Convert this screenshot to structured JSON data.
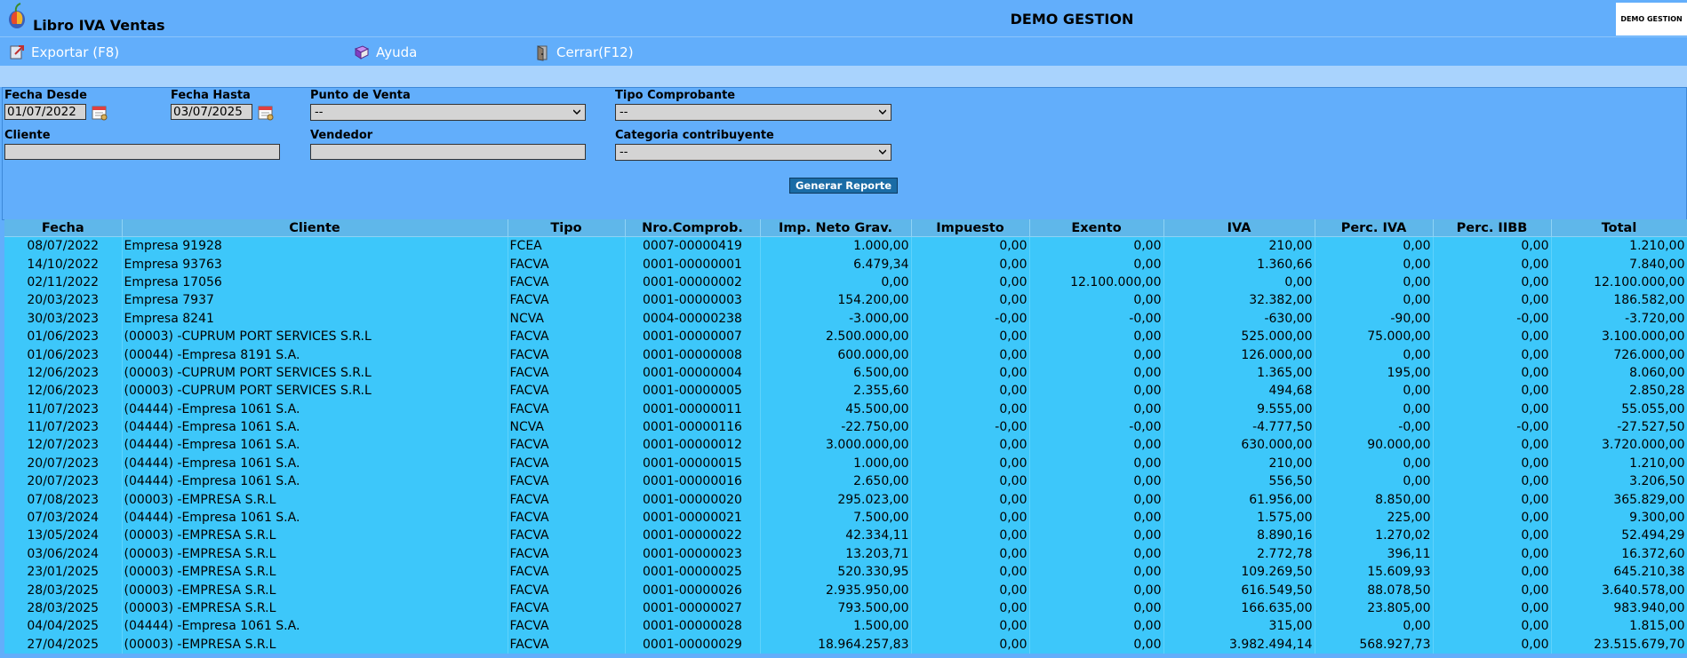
{
  "header": {
    "app_title": "Libro IVA Ventas",
    "company": "DEMO GESTION",
    "logo_text": "DEMO GESTION"
  },
  "toolbar": {
    "export_label": "Exportar (F8)",
    "help_label": "Ayuda",
    "close_label": "Cerrar(F12)"
  },
  "filters": {
    "fecha_desde_label": "Fecha Desde",
    "fecha_desde_value": "01/07/2022",
    "fecha_hasta_label": "Fecha Hasta",
    "fecha_hasta_value": "03/07/2025",
    "punto_venta_label": "Punto de Venta",
    "punto_venta_value": "--",
    "tipo_comprobante_label": "Tipo Comprobante",
    "tipo_comprobante_value": "--",
    "cliente_label": "Cliente",
    "cliente_value": "",
    "vendedor_label": "Vendedor",
    "vendedor_value": "",
    "categoria_label": "Categoria contribuyente",
    "categoria_value": "--",
    "generate_button": "Generar Reporte"
  },
  "table": {
    "columns": [
      "Fecha",
      "Cliente",
      "Tipo",
      "Nro.Comprob.",
      "Imp. Neto Grav.",
      "Impuesto",
      "Exento",
      "IVA",
      "Perc. IVA",
      "Perc. IIBB",
      "Total"
    ],
    "rows": [
      [
        "08/07/2022",
        "Empresa 91928",
        "FCEA",
        "0007-00000419",
        "1.000,00",
        "0,00",
        "0,00",
        "210,00",
        "0,00",
        "0,00",
        "1.210,00"
      ],
      [
        "14/10/2022",
        "Empresa 93763",
        "FACVA",
        "0001-00000001",
        "6.479,34",
        "0,00",
        "0,00",
        "1.360,66",
        "0,00",
        "0,00",
        "7.840,00"
      ],
      [
        "02/11/2022",
        "Empresa 17056",
        "FACVA",
        "0001-00000002",
        "0,00",
        "0,00",
        "12.100.000,00",
        "0,00",
        "0,00",
        "0,00",
        "12.100.000,00"
      ],
      [
        "20/03/2023",
        "Empresa 7937",
        "FACVA",
        "0001-00000003",
        "154.200,00",
        "0,00",
        "0,00",
        "32.382,00",
        "0,00",
        "0,00",
        "186.582,00"
      ],
      [
        "30/03/2023",
        "Empresa 8241",
        "NCVA",
        "0004-00000238",
        "-3.000,00",
        "-0,00",
        "-0,00",
        "-630,00",
        "-90,00",
        "-0,00",
        "-3.720,00"
      ],
      [
        "01/06/2023",
        "(00003) -CUPRUM PORT SERVICES S.R.L",
        "FACVA",
        "0001-00000007",
        "2.500.000,00",
        "0,00",
        "0,00",
        "525.000,00",
        "75.000,00",
        "0,00",
        "3.100.000,00"
      ],
      [
        "01/06/2023",
        "(00044) -Empresa 8191 S.A.",
        "FACVA",
        "0001-00000008",
        "600.000,00",
        "0,00",
        "0,00",
        "126.000,00",
        "0,00",
        "0,00",
        "726.000,00"
      ],
      [
        "12/06/2023",
        "(00003) -CUPRUM PORT SERVICES S.R.L",
        "FACVA",
        "0001-00000004",
        "6.500,00",
        "0,00",
        "0,00",
        "1.365,00",
        "195,00",
        "0,00",
        "8.060,00"
      ],
      [
        "12/06/2023",
        "(00003) -CUPRUM PORT SERVICES S.R.L",
        "FACVA",
        "0001-00000005",
        "2.355,60",
        "0,00",
        "0,00",
        "494,68",
        "0,00",
        "0,00",
        "2.850,28"
      ],
      [
        "11/07/2023",
        "(04444) -Empresa 1061 S.A.",
        "FACVA",
        "0001-00000011",
        "45.500,00",
        "0,00",
        "0,00",
        "9.555,00",
        "0,00",
        "0,00",
        "55.055,00"
      ],
      [
        "11/07/2023",
        "(04444) -Empresa 1061 S.A.",
        "NCVA",
        "0001-00000116",
        "-22.750,00",
        "-0,00",
        "-0,00",
        "-4.777,50",
        "-0,00",
        "-0,00",
        "-27.527,50"
      ],
      [
        "12/07/2023",
        "(04444) -Empresa 1061 S.A.",
        "FACVA",
        "0001-00000012",
        "3.000.000,00",
        "0,00",
        "0,00",
        "630.000,00",
        "90.000,00",
        "0,00",
        "3.720.000,00"
      ],
      [
        "20/07/2023",
        "(04444) -Empresa 1061 S.A.",
        "FACVA",
        "0001-00000015",
        "1.000,00",
        "0,00",
        "0,00",
        "210,00",
        "0,00",
        "0,00",
        "1.210,00"
      ],
      [
        "20/07/2023",
        "(04444) -Empresa 1061 S.A.",
        "FACVA",
        "0001-00000016",
        "2.650,00",
        "0,00",
        "0,00",
        "556,50",
        "0,00",
        "0,00",
        "3.206,50"
      ],
      [
        "07/08/2023",
        "(00003) -EMPRESA S.R.L",
        "FACVA",
        "0001-00000020",
        "295.023,00",
        "0,00",
        "0,00",
        "61.956,00",
        "8.850,00",
        "0,00",
        "365.829,00"
      ],
      [
        "07/03/2024",
        "(04444) -Empresa 1061 S.A.",
        "FACVA",
        "0001-00000021",
        "7.500,00",
        "0,00",
        "0,00",
        "1.575,00",
        "225,00",
        "0,00",
        "9.300,00"
      ],
      [
        "13/05/2024",
        "(00003) -EMPRESA S.R.L",
        "FACVA",
        "0001-00000022",
        "42.334,11",
        "0,00",
        "0,00",
        "8.890,16",
        "1.270,02",
        "0,00",
        "52.494,29"
      ],
      [
        "03/06/2024",
        "(00003) -EMPRESA S.R.L",
        "FACVA",
        "0001-00000023",
        "13.203,71",
        "0,00",
        "0,00",
        "2.772,78",
        "396,11",
        "0,00",
        "16.372,60"
      ],
      [
        "23/01/2025",
        "(00003) -EMPRESA S.R.L",
        "FACVA",
        "0001-00000025",
        "520.330,95",
        "0,00",
        "0,00",
        "109.269,50",
        "15.609,93",
        "0,00",
        "645.210,38"
      ],
      [
        "28/03/2025",
        "(00003) -EMPRESA S.R.L",
        "FACVA",
        "0001-00000026",
        "2.935.950,00",
        "0,00",
        "0,00",
        "616.549,50",
        "88.078,50",
        "0,00",
        "3.640.578,00"
      ],
      [
        "28/03/2025",
        "(00003) -EMPRESA S.R.L",
        "FACVA",
        "0001-00000027",
        "793.500,00",
        "0,00",
        "0,00",
        "166.635,00",
        "23.805,00",
        "0,00",
        "983.940,00"
      ],
      [
        "04/04/2025",
        "(04444) -Empresa 1061 S.A.",
        "FACVA",
        "0001-00000028",
        "1.500,00",
        "0,00",
        "0,00",
        "315,00",
        "0,00",
        "0,00",
        "1.815,00"
      ],
      [
        "27/04/2025",
        "(00003) -EMPRESA S.R.L",
        "FACVA",
        "0001-00000029",
        "18.964.257,83",
        "0,00",
        "0,00",
        "3.982.494,14",
        "568.927,73",
        "0,00",
        "23.515.679,70"
      ]
    ]
  }
}
